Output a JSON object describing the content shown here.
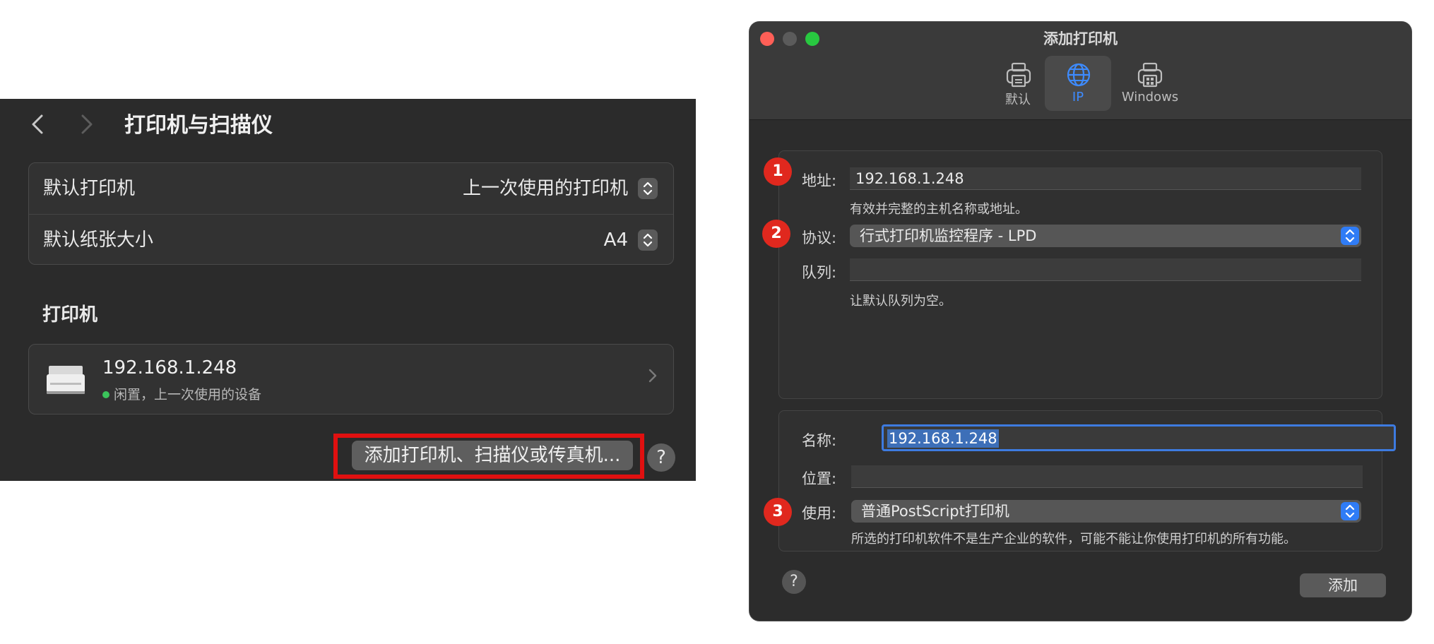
{
  "left_panel": {
    "title": "打印机与扫描仪",
    "back_icon": "chevron-left-icon",
    "forward_icon": "chevron-right-icon",
    "settings": [
      {
        "label": "默认打印机",
        "value": "上一次使用的打印机"
      },
      {
        "label": "默认纸张大小",
        "value": "A4"
      }
    ],
    "section_title": "打印机",
    "printer": {
      "name": "192.168.1.248",
      "status": "闲置，上一次使用的设备",
      "status_color": "#3bc45b"
    },
    "add_button": "添加打印机、扫描仪或传真机...",
    "help": "?",
    "highlight_color": "#e01010"
  },
  "dialog": {
    "title": "添加打印机",
    "toolbar": [
      {
        "label": "默认",
        "icon": "printer-icon"
      },
      {
        "label": "IP",
        "icon": "globe-icon",
        "selected": true
      },
      {
        "label": "Windows",
        "icon": "windows-printer-icon"
      }
    ],
    "address": {
      "label": "地址:",
      "value": "192.168.1.248",
      "hint": "有效并完整的主机名称或地址。"
    },
    "protocol": {
      "label": "协议:",
      "value": "行式打印机监控程序 - LPD"
    },
    "queue": {
      "label": "队列:",
      "value": "",
      "hint": "让默认队列为空。"
    },
    "name": {
      "label": "名称:",
      "value": "192.168.1.248"
    },
    "location": {
      "label": "位置:",
      "value": ""
    },
    "use": {
      "label": "使用:",
      "value": "普通PostScript打印机",
      "hint": "所选的打印机软件不是生产企业的软件，可能不能让你使用打印机的所有功能。"
    },
    "help": "?",
    "add_button": "添加",
    "badges": [
      "1",
      "2",
      "3"
    ],
    "accent_color": "#2f7cf6",
    "badge_color": "#e0281e"
  }
}
